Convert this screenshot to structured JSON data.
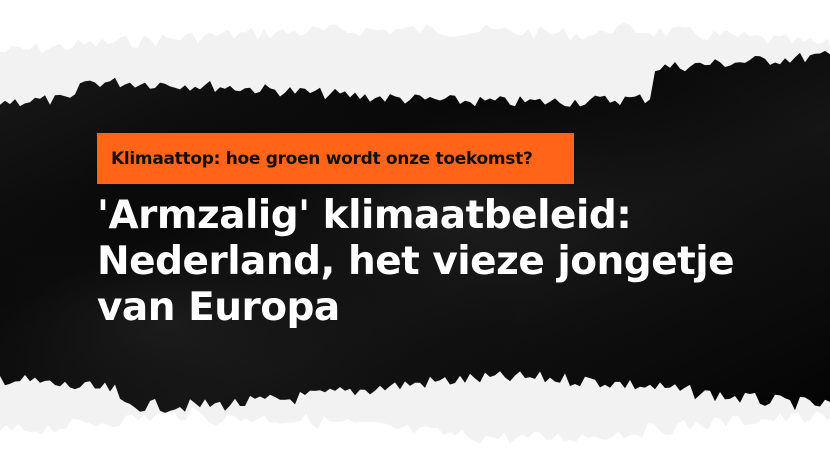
{
  "kicker": "Klimaattop: hoe groen wordt onze toekomst?",
  "headline": {
    "line1": "'Armzalig' klimaatbeleid:",
    "line2": "Nederland, het vieze jongetje",
    "line3": "van Europa"
  },
  "colors": {
    "kicker_background": "#ff6418",
    "kicker_text": "#111111",
    "headline_text": "#ffffff",
    "paper_black": "#0b0b0b",
    "paper_white": "#f2f2f2",
    "background": "#ffffff"
  }
}
